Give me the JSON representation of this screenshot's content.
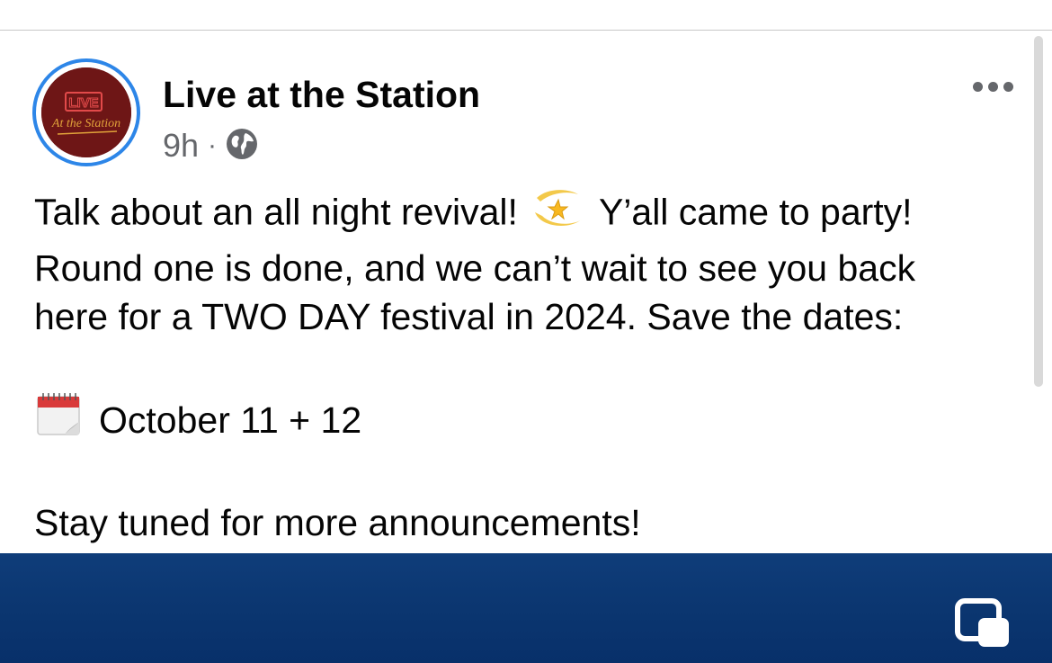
{
  "post": {
    "page_name": "Live at the Station",
    "timestamp": "9h",
    "separator": "·",
    "avatar": {
      "logo_top": "LIVE",
      "logo_script": "At the Station",
      "background": "#6e1616",
      "ring_color": "#2d86e8"
    },
    "body": {
      "line1_a": "Talk about an all night revival!",
      "line1_b": "Y’all came to party!",
      "line2": "Round one is done, and we can’t wait to see you back",
      "line3": "here for a TWO DAY festival in 2024. Save the dates:",
      "date": "October 11 + 12",
      "closing": "Stay tuned for more announcements!"
    },
    "icons": {
      "privacy": "globe-icon",
      "more": "more-options-icon",
      "sparkle": "dizzy-star-emoji",
      "calendar": "spiral-calendar-emoji",
      "pip": "picture-in-picture-icon"
    }
  },
  "colors": {
    "name_text": "#050505",
    "meta_text": "#65676b",
    "image_blue": "#0b3670"
  }
}
